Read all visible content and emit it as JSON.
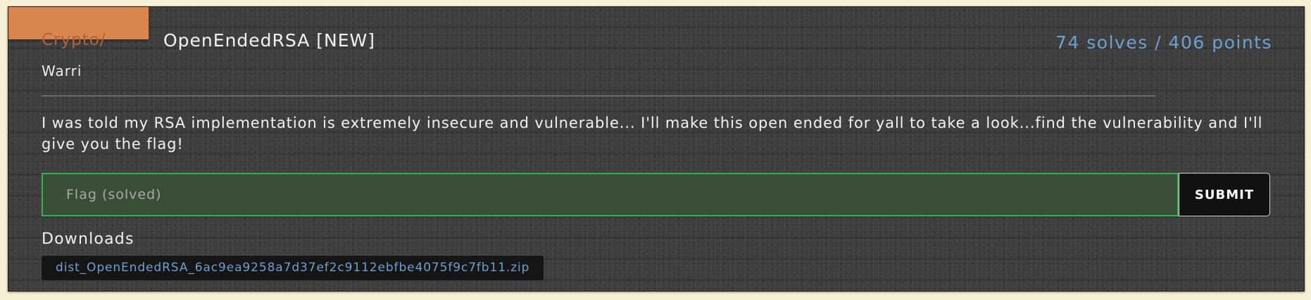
{
  "challenge": {
    "category": "Crypto/",
    "title": "OpenEndedRSA [NEW]",
    "score": "74 solves / 406 points",
    "author": "Warri",
    "description": "I was told my RSA implementation is extremely insecure and vulnerable... I'll make this open ended for yall to take a look...find the vulnerability and I'll give you the flag!"
  },
  "flag_form": {
    "placeholder": "Flag (solved)",
    "value": "",
    "submit_label": "SUBMIT"
  },
  "downloads": {
    "heading": "Downloads",
    "files": [
      {
        "name": "dist_OpenEndedRSA_6ac9ea9258a7d37ef2c9112ebfbe4075f9c7fb11.zip"
      }
    ]
  },
  "colors": {
    "accent_tab": "#d9854e",
    "score_text": "#6ba1cf",
    "solved_border": "#2fb14e",
    "solved_fill": "#3a4d37",
    "card_background": "#3e3e3e"
  }
}
